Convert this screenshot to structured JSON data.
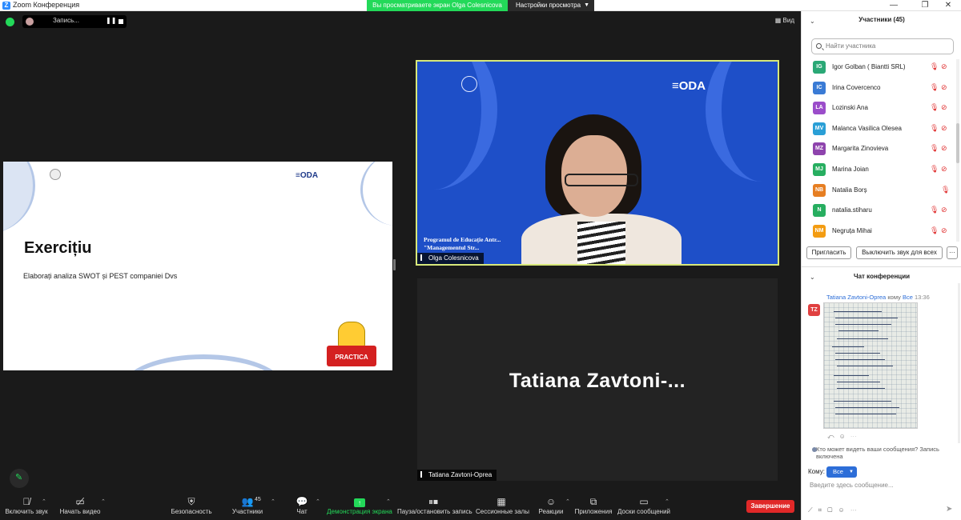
{
  "window": {
    "title": "Zoom Конференция",
    "minimize": "—",
    "restore": "❐",
    "close": "✕"
  },
  "share_banner": {
    "text": "Вы просматриваете экран Olga Colesnicova",
    "view_settings": "Настройки просмотра"
  },
  "recording": {
    "label": "Запись...",
    "pause": "❚❚"
  },
  "view_button": "Вид",
  "slide": {
    "heading": "Exercițiu",
    "subtext": "Elaborați analiza SWOT și PEST companiei Dvs",
    "oda": "ODA",
    "practica": "PRACTICA"
  },
  "videos": {
    "olga": {
      "name": "Olga Colesnicova",
      "oda": "ODA",
      "program_text": "Programul de Educație Antr... \"Managementul Str..."
    },
    "tatiana": {
      "name": "Tatiana Zavtoni-Oprea",
      "display_name": "Tatiana  Zavtoni-..."
    }
  },
  "toolbar": {
    "unmute": "Включить звук",
    "start_video": "Начать видео",
    "security": "Безопасность",
    "participants": "Участники",
    "participants_count": "45",
    "chat": "Чат",
    "share": "Демонстрация экрана",
    "pause_recording": "Пауза/остановить запись",
    "breakout": "Сессионные залы",
    "reactions": "Реакции",
    "apps": "Приложения",
    "whiteboards": "Доски сообщений",
    "end": "Завершение"
  },
  "participants_panel": {
    "header": "Участники (45)",
    "search_placeholder": "Найти участника",
    "participants": [
      {
        "initials": "IG",
        "name": "Igor Golban ( Biantti SRL)",
        "color": "#2aa876",
        "video_off": true
      },
      {
        "initials": "IC",
        "name": "Irina Covercenco",
        "color": "#3a7bd5",
        "video_off": true
      },
      {
        "initials": "LA",
        "name": "Lozinski Ana",
        "color": "#9b4dca",
        "video_off": true
      },
      {
        "initials": "MV",
        "name": "Malanca Vasilica Olesea",
        "color": "#2a9fd6",
        "video_off": true
      },
      {
        "initials": "MZ",
        "name": "Margarita Zinovieva",
        "color": "#8e44ad",
        "video_off": true
      },
      {
        "initials": "MJ",
        "name": "Marina Joian",
        "color": "#27ae60",
        "video_off": true
      },
      {
        "initials": "NB",
        "name": "Natalia Borș",
        "color": "#e67e22",
        "video_off": false
      },
      {
        "initials": "N",
        "name": "natalia.stiharu",
        "color": "#27ae60",
        "video_off": true
      },
      {
        "initials": "NM",
        "name": "Negruța Mihai",
        "color": "#f39c12",
        "video_off": true
      }
    ],
    "invite": "Пригласить",
    "mute_all": "Выключить звук для всех",
    "more": "···"
  },
  "chat_panel": {
    "header": "Чат конференции",
    "sender": "Tatiana Zavtoni-Oprea",
    "to_word": "кому",
    "to_all": "Все",
    "time": "13:36",
    "sender_initials": "TZ",
    "visibility_text": "Кто может видеть ваши сообщения? Запись включена",
    "to_label": "Кому:",
    "to_value": "Все",
    "input_placeholder": "Введите здесь сообщение..."
  }
}
